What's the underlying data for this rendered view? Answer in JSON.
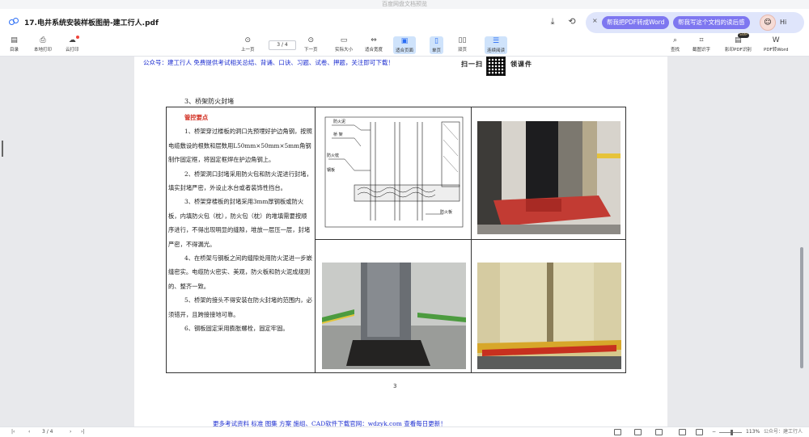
{
  "window": {
    "system_title": "百度网盘文档预览",
    "doc_title": "17.电井系统安装样板图册-建工行人.pdf"
  },
  "titlebar": {
    "icons": [
      "download-icon",
      "share-icon"
    ],
    "ai": {
      "close": "×",
      "pill1": "帮我把PDF转成Word",
      "pill2": "帮我写这个文档的读后感",
      "greeting": "Hi"
    }
  },
  "toolbar": {
    "left": [
      {
        "label": "目录",
        "icon": "toc-icon"
      },
      {
        "label": "本地打印",
        "icon": "print-icon"
      },
      {
        "label": "云打印",
        "icon": "cloud-print-icon"
      }
    ],
    "prev": "上一页",
    "page_indicator": "3 / 4",
    "next": "下一页",
    "actual_size": "实际大小",
    "fit_width": "适合宽度",
    "fit_page": "适合页面",
    "single": "单页",
    "double": "双页",
    "continuous": "连续阅读",
    "right": [
      {
        "label": "查找",
        "icon": "search-icon"
      },
      {
        "label": "截图识字",
        "icon": "screenshot-ocr-icon"
      },
      {
        "label": "影印PDF识别",
        "icon": "scan-pdf-icon",
        "badge": "SVIP"
      },
      {
        "label": "PDF转Word",
        "icon": "pdf-to-word-icon"
      }
    ]
  },
  "page": {
    "header_note": "公众号：建工行人 免费提供考试相关总结、背诵、口诀、习题、试卷、押题，关注即可下载！",
    "brand_left": "扫一扫",
    "brand_right": "领课件",
    "section_title": "3、桥架防火封堵",
    "key_points": "管控要点",
    "paragraphs": [
      "1、桥架穿过楼板的洞口先预埋好护边角钢，按照电缆敷设的根数和层数用L50mm×50mm×5mm角钢制作固定框，将固定框焊在护边角钢上。",
      "2、桥架洞口封堵采用防火包和防火泥进行封堵，填实封堵严密，外设止水台或者装饰性挡台。",
      "3、桥架穿楼板的封堵采用3mm厚钢板或防火板，内填防火包（枕），防火包（枕）的堆填需要按顺序进行，不得出现明显的缝隙，堆放一层压一层，封堵严密，不得漏光。",
      "4、在桥架与钢板之间的缝隙处用防火泥进一步嵌缝密实。电缆防火密实、美观，防火板和防火泥成规则的、整齐一致。",
      "5、桥架的接头不得安装在防火封堵的范围内，必须错开，且跨接接地可靠。",
      "6、钢板固定采用膨胀螺栓，固定牢固。"
    ],
    "drawing_labels": [
      "防火泥",
      "桥 架",
      "防火枕",
      "钢板",
      "防火板"
    ],
    "page_number": "3",
    "footer_note": "更多考试资料 标准 图集 方案 施组、CAD软件下载官网：wdzyk.com 查看每日更新！"
  },
  "statusbar": {
    "page_indicator": "3 / 4",
    "zoom": "113%",
    "watermark": "公众号：建工行人"
  }
}
